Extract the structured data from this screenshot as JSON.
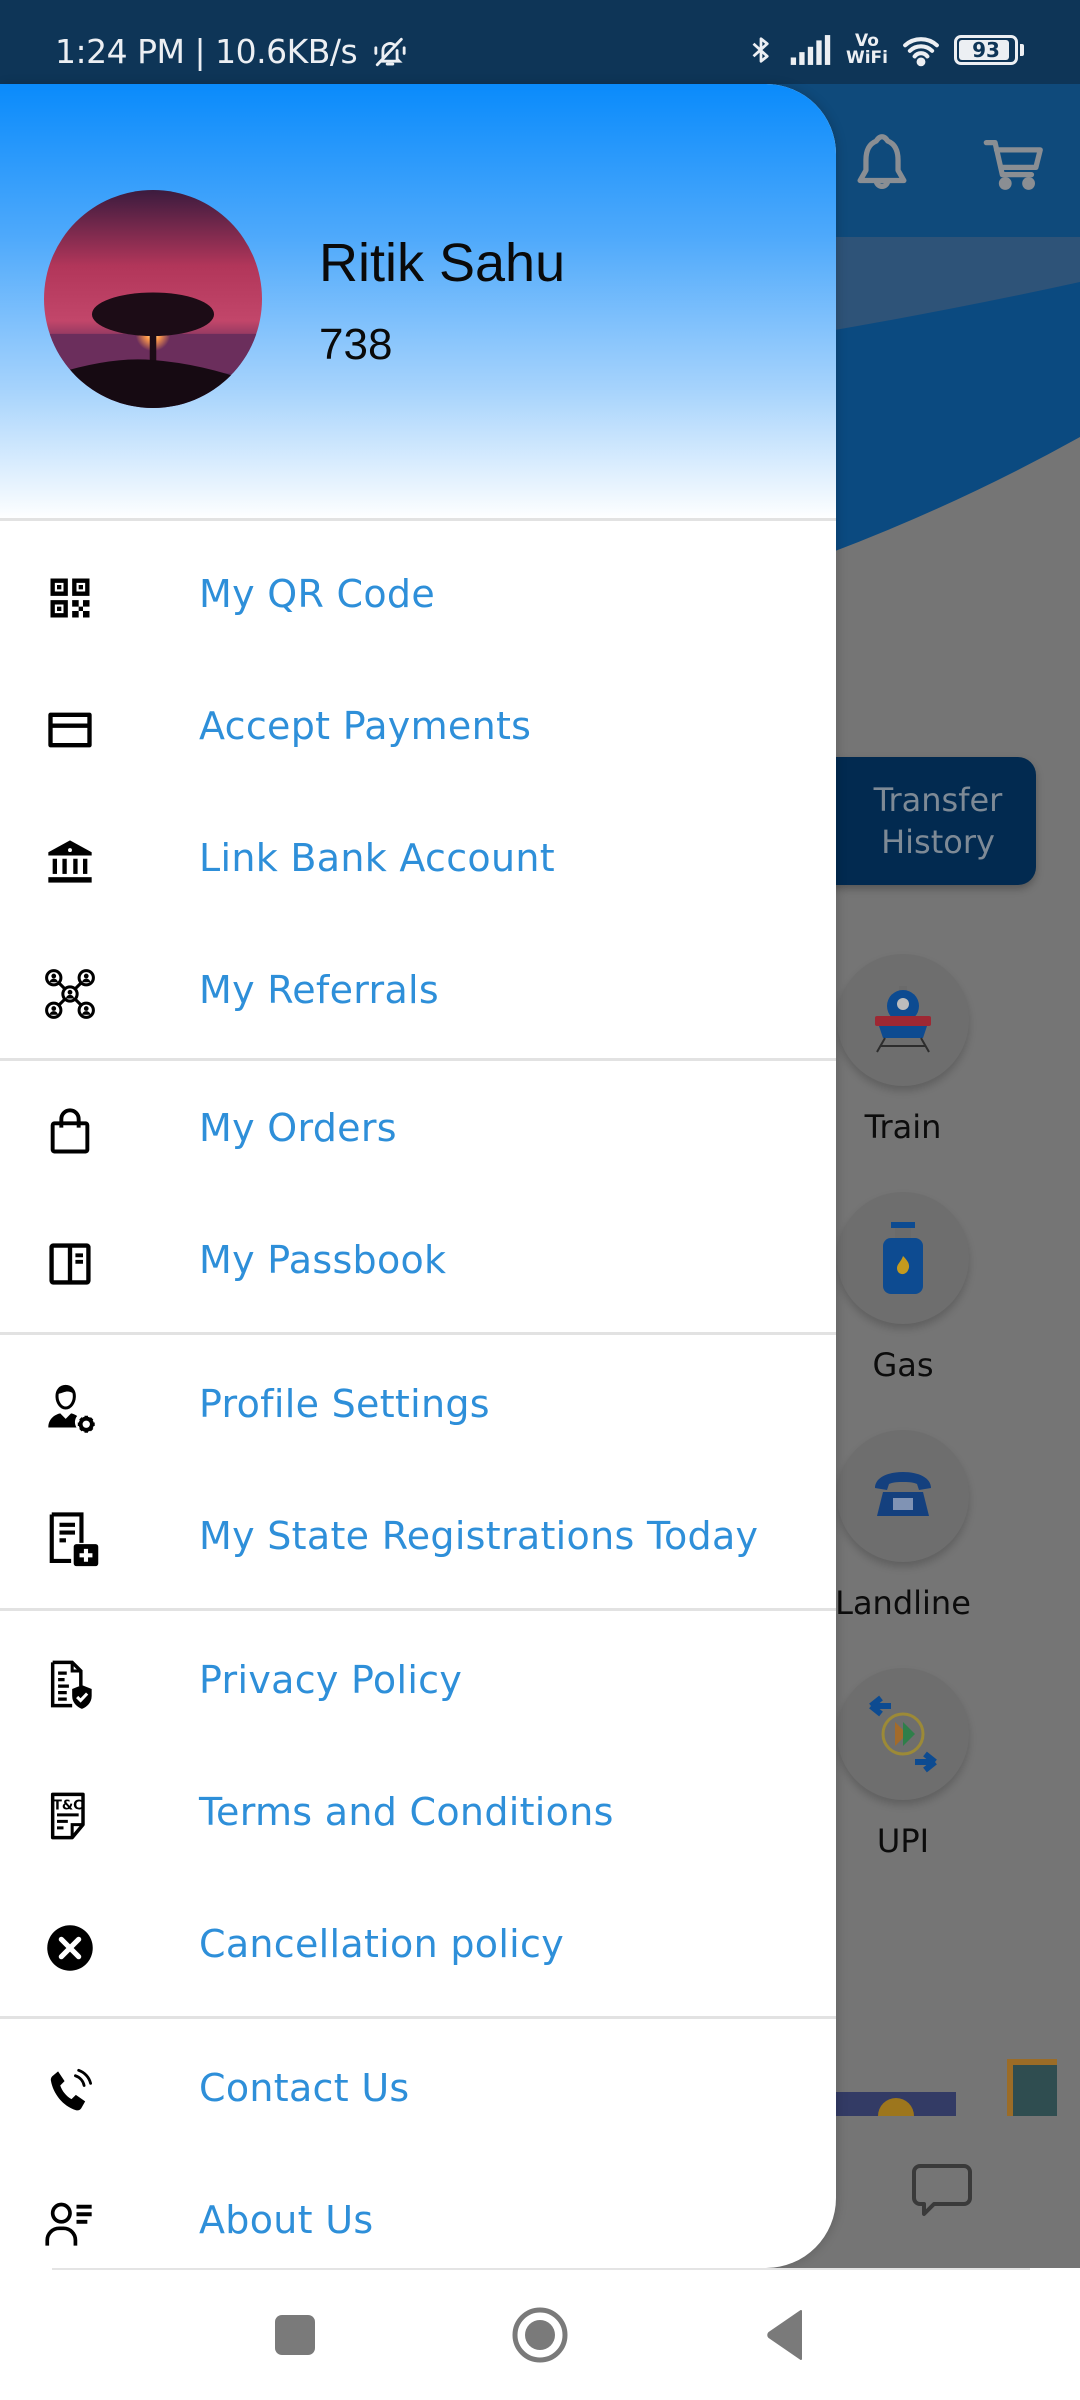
{
  "status_bar": {
    "time": "1:24 PM",
    "separator": "|",
    "net_speed": "10.6KB/s",
    "icons": [
      "mute-icon",
      "bluetooth-icon",
      "signal-icon",
      "vowifi-icon",
      "wifi-icon",
      "battery-icon"
    ],
    "vowifi_top": "Vo",
    "vowifi_bottom": "WiFi",
    "battery_level": "93"
  },
  "drawer": {
    "user": {
      "name": "Ritik Sahu",
      "points": "738"
    },
    "colors": {
      "header_top": "#0A8BFB",
      "label": "#2E8FD9",
      "icon": "#000000"
    },
    "menu": [
      {
        "id": "qr",
        "label": "My QR Code",
        "icon": "qr-code-icon"
      },
      {
        "id": "accept-payments",
        "label": "Accept Payments",
        "icon": "credit-card-icon"
      },
      {
        "id": "link-bank",
        "label": "Link Bank Account",
        "icon": "bank-icon"
      },
      {
        "id": "referrals",
        "label": "My Referrals",
        "icon": "referral-network-icon"
      },
      {
        "id": "orders",
        "label": "My Orders",
        "icon": "shopping-bag-icon"
      },
      {
        "id": "passbook",
        "label": "My Passbook",
        "icon": "passbook-icon"
      },
      {
        "id": "profile-settings",
        "label": "Profile Settings",
        "icon": "user-settings-icon"
      },
      {
        "id": "state-registrations",
        "label": "My State Registrations Today",
        "icon": "document-add-icon"
      },
      {
        "id": "privacy",
        "label": "Privacy Policy",
        "icon": "document-shield-icon"
      },
      {
        "id": "terms",
        "label": "Terms and Conditions",
        "icon": "terms-document-icon"
      },
      {
        "id": "cancellation",
        "label": "Cancellation policy",
        "icon": "cancel-circle-icon"
      },
      {
        "id": "contact",
        "label": "Contact Us",
        "icon": "phone-call-icon"
      },
      {
        "id": "about",
        "label": "About Us",
        "icon": "user-info-icon"
      }
    ],
    "terms_icon_text": "T&C"
  },
  "background_app": {
    "top_icons": [
      "bell-icon",
      "cart-icon"
    ],
    "transfer_button": {
      "line1": "Transfer",
      "line2": "History"
    },
    "services": [
      {
        "label": "Train",
        "icon": "train-icon"
      },
      {
        "label": "Gas",
        "icon": "gas-cylinder-icon"
      },
      {
        "label": "Landline",
        "icon": "telephone-icon"
      },
      {
        "label": "UPI",
        "icon": "upi-icon"
      }
    ],
    "chat_icon": "chat-bubble-icon",
    "colors": {
      "topbar": "#0F4A7B",
      "overlay_bg": "#757575",
      "transfer_button": "#022A50"
    }
  },
  "nav_bar": {
    "buttons": [
      "recents-button",
      "home-button",
      "back-button"
    ]
  }
}
